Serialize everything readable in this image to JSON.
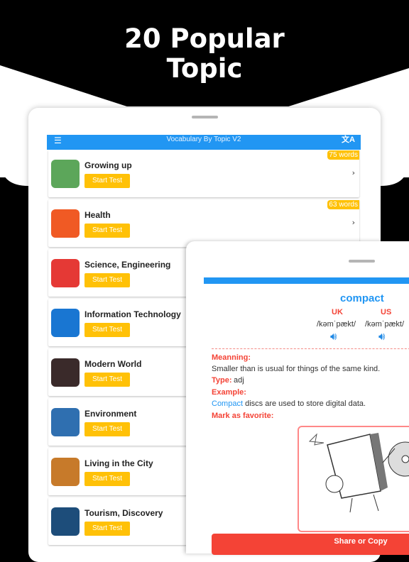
{
  "headline": {
    "line1": "20 Popular",
    "line2": "Topic"
  },
  "app": {
    "title": "Vocabulary By Topic V2",
    "menu_icon": "hamburger-icon",
    "translate_icon": "translate-icon"
  },
  "topics": [
    {
      "name": "Growing up",
      "button": "Start Test",
      "words": "75 words",
      "color": "#5ca65a"
    },
    {
      "name": "Health",
      "button": "Start Test",
      "words": "63 words",
      "color": "#f05a24"
    },
    {
      "name": "Science, Engineering",
      "button": "Start Test",
      "color": "#e53935"
    },
    {
      "name": "Information Technology",
      "button": "Start Test",
      "color": "#1976d2"
    },
    {
      "name": "Modern World",
      "button": "Start Test",
      "color": "#3a2a2a"
    },
    {
      "name": "Environment",
      "button": "Start Test",
      "color": "#2f6fb0"
    },
    {
      "name": "Living in the City",
      "button": "Start Test",
      "color": "#c77a2a"
    },
    {
      "name": "Tourism, Discovery",
      "button": "Start Test",
      "color": "#1d4d7a"
    }
  ],
  "detail": {
    "word": "compact",
    "uk_label": "UK",
    "us_label": "US",
    "uk_ipa": "/kəmˈpækt/",
    "us_ipa": "/kəmˈpækt/",
    "meaning_label": "Meanning:",
    "meaning": "Smaller than is usual for things of the same kind.",
    "type_label": "Type:",
    "type": "adj",
    "example_label": "Example:",
    "example_word": "Compact",
    "example_rest": " discs are used to store digital data.",
    "favorite_label": "Mark as favorite:",
    "share_button": "Share or Copy"
  }
}
